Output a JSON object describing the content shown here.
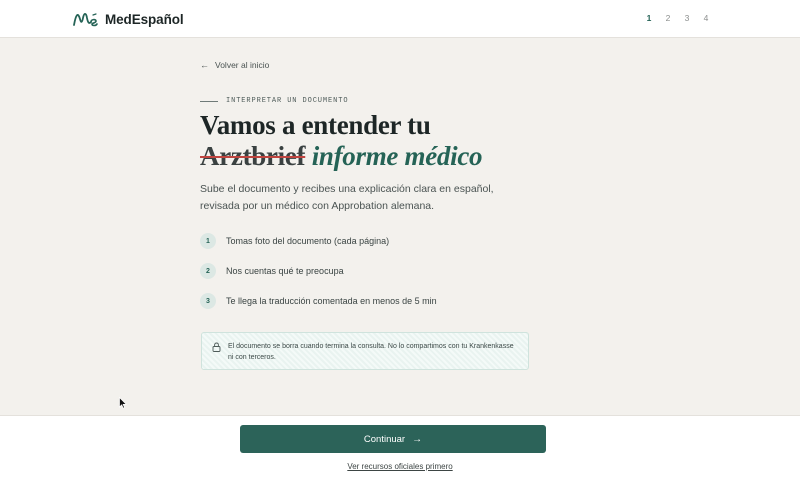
{
  "header": {
    "brand_name": "MedEspañol",
    "steps": [
      "1",
      "2",
      "3",
      "4"
    ],
    "active_step": 1
  },
  "main": {
    "back_link": "Volver al inicio",
    "eyebrow": "INTERPRETAR UN DOCUMENTO",
    "heading": {
      "line1": "Vamos a entender tu",
      "struck_word": "Arztbrief",
      "accent_text": "informe médico"
    },
    "lead": "Sube el documento y recibes una explicación clara en español, revisada por un médico con Approbation alemana.",
    "steps": [
      {
        "number": "1",
        "text": "Tomas foto del documento (cada página)"
      },
      {
        "number": "2",
        "text": "Nos cuentas qué te preocupa"
      },
      {
        "number": "3",
        "text": "Te llega la traducción comentada en menos de 5 min"
      }
    ],
    "notice": "El documento se borra cuando termina la consulta. No lo compartimos con tu Krankenkasse ni con terceros."
  },
  "footer": {
    "continue_label": "Continuar",
    "resources_link": "Ver recursos oficiales primero"
  },
  "icons": {
    "logo": "medespanol-logo-icon",
    "back": "arrow-left-icon",
    "lock": "lock-icon",
    "continue": "arrow-right-icon",
    "cursor": "mouse-pointer-icon"
  },
  "colors": {
    "brand": "#256356",
    "button": "#2c6359",
    "strike": "#c0443f",
    "background": "#f3f1ed"
  }
}
